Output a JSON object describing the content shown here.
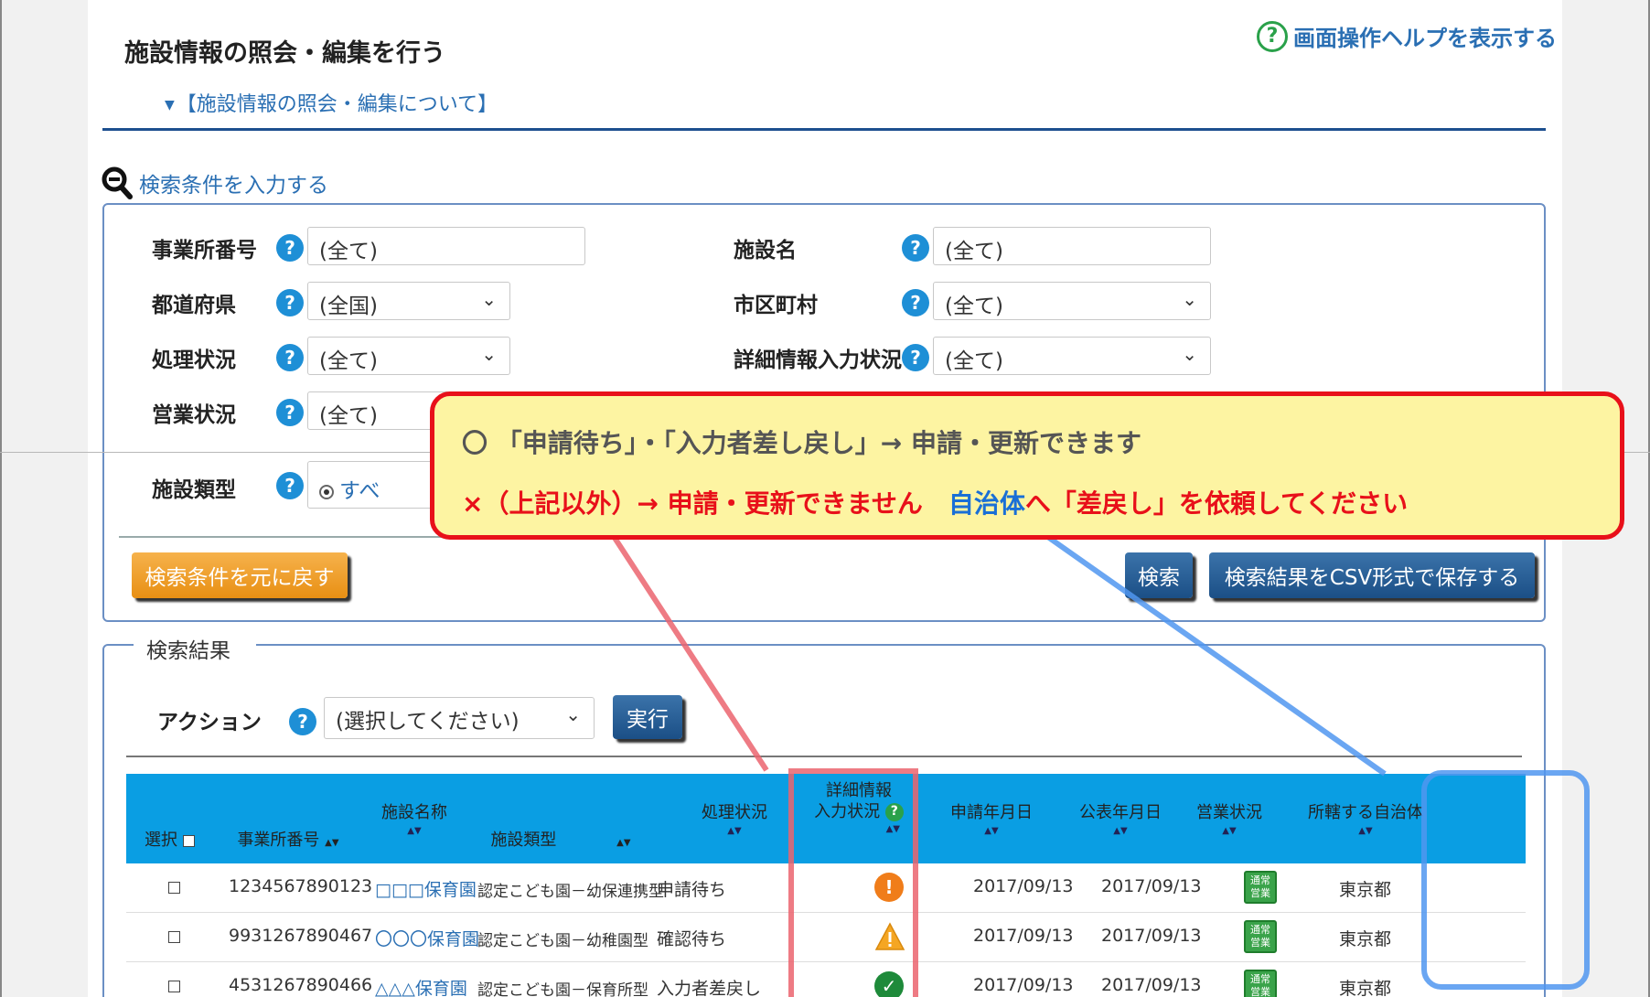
{
  "page": {
    "title": "施設情報の照会・編集を行う",
    "about_link": "【施設情報の照会・編集について】",
    "help_link": "画面操作ヘルプを表示する",
    "help_icon_char": "?"
  },
  "search": {
    "heading": "検索条件を入力する",
    "fields": {
      "office_number": {
        "label": "事業所番号",
        "value": "(全て)"
      },
      "facility_name": {
        "label": "施設名",
        "value": "(全て)"
      },
      "prefecture": {
        "label": "都道府県",
        "value": "(全国)"
      },
      "city": {
        "label": "市区町村",
        "value": "(全て)"
      },
      "process_status": {
        "label": "処理状況",
        "value": "(全て)"
      },
      "detail_status": {
        "label": "詳細情報入力状況",
        "value": "(全て)"
      },
      "business_status": {
        "label": "営業状況",
        "value": "(全て)"
      },
      "facility_type": {
        "label": "施設類型",
        "value": "すべ"
      }
    },
    "help_char": "?",
    "reset_button": "検索条件を元に戻す",
    "search_button": "検索",
    "csv_button": "検索結果をCSV形式で保存する"
  },
  "results": {
    "legend": "検索結果",
    "action_label": "アクション",
    "action_select": "(選択してください)",
    "execute_button": "実行",
    "columns": {
      "select": "選択",
      "office_number": "事業所番号",
      "facility_name": "施設名称",
      "facility_type": "施設類型",
      "process_status": "処理状況",
      "detail_line1": "詳細情報",
      "detail_line2": "入力状況",
      "apply_date": "申請年月日",
      "publish_date": "公表年月日",
      "business_status": "営業状況",
      "municipality": "所轄する自治体"
    },
    "rows": [
      {
        "office_number": "1234567890123",
        "facility_name": "□□□保育園",
        "facility_type": "認定こども園－幼保連携型",
        "process_status": "申請待ち",
        "detail_icon": "exclamation-circle-icon",
        "apply_date": "2017/09/13",
        "publish_date": "2017/09/13",
        "badge": "通常営業",
        "municipality": "東京都"
      },
      {
        "office_number": "9931267890467",
        "facility_name": "〇〇〇保育園",
        "facility_type": "認定こども園－幼稚園型",
        "process_status": "確認待ち",
        "detail_icon": "warning-triangle-icon",
        "apply_date": "2017/09/13",
        "publish_date": "2017/09/13",
        "badge": "通常営業",
        "municipality": "東京都"
      },
      {
        "office_number": "4531267890466",
        "facility_name": "△△△保育園",
        "facility_type": "認定こども園－保育所型",
        "process_status": "入力者差戻し",
        "detail_icon": "check-circle-icon",
        "apply_date": "2017/09/13",
        "publish_date": "2017/09/13",
        "badge": "通常営業",
        "municipality": "東京都"
      }
    ]
  },
  "callout": {
    "line1": "〇 「申請待ち」・「入力者差し戻し」→ 申請・更新できます",
    "line2_red": "×（上記以外）→ 申請・更新できません　",
    "line2_blue": "自治体",
    "line2_red_tail": "へ「差戻し」を依頼してください"
  },
  "colors": {
    "header_blue": "#0a9ee3",
    "callout_border": "#e8101a",
    "callout_fill": "#fdf4a2",
    "link_blue": "#2a6fb3",
    "badge_green": "#3aa34a"
  }
}
